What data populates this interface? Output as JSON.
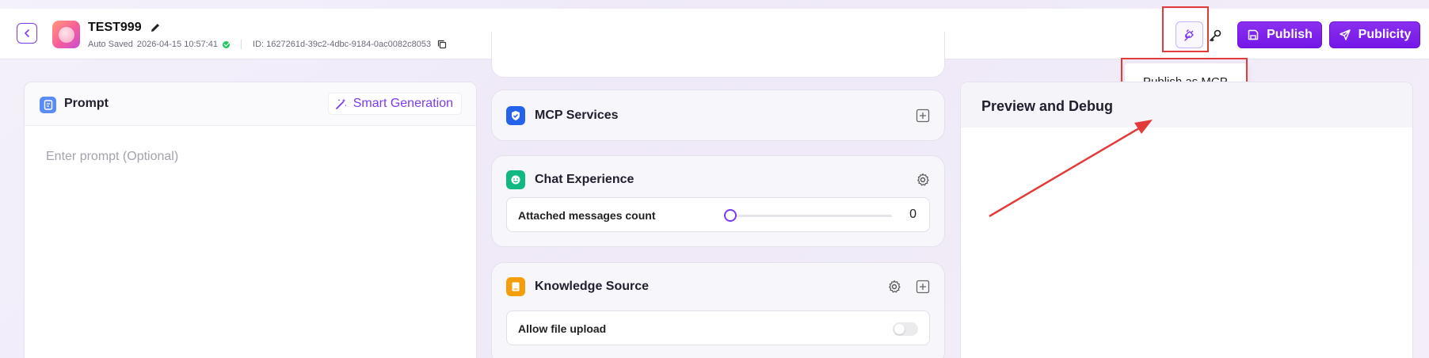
{
  "header": {
    "title": "TEST999",
    "saved_label": "Auto Saved",
    "saved_time": "2026-04-15 10:57:41",
    "id_text": "ID: 1627261d-39c2-4dbc-9184-0ac0082c8053",
    "publish_label": "Publish",
    "publicity_label": "Publicity",
    "tooltip": "Publish as MCP"
  },
  "prompt": {
    "title": "Prompt",
    "smart_generation": "Smart Generation",
    "placeholder": "Enter prompt (Optional)"
  },
  "middle": {
    "mcp_title": "MCP Services",
    "chat_title": "Chat Experience",
    "attached_label": "Attached messages count",
    "attached_value": "0",
    "knowledge_title": "Knowledge Source",
    "allow_upload_label": "Allow file upload"
  },
  "preview": {
    "title": "Preview and Debug"
  },
  "colors": {
    "accent": "#7c3aed",
    "annotation": "#e23b3b"
  }
}
